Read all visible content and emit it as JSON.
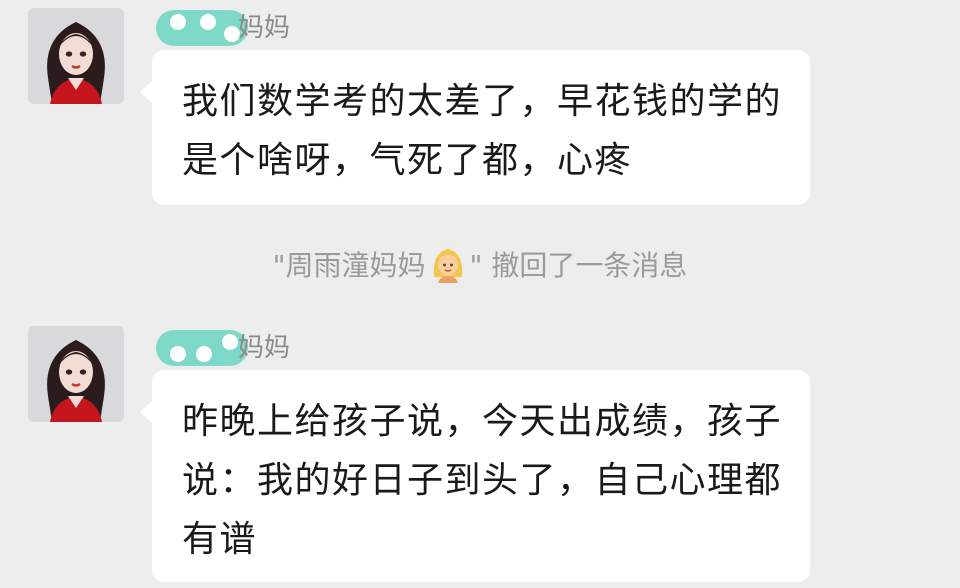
{
  "messages": [
    {
      "sender": "妈妈",
      "text": "我们数学考的太差了，早花钱的学的是个啥呀，气死了都，心疼"
    },
    {
      "sender": "妈妈",
      "text": "昨晚上给孩子说，今天出成绩，孩子说：我的好日子到头了，自己心理都有谱"
    }
  ],
  "system_notice": {
    "quote_open": "\"",
    "name": "周雨潼妈妈",
    "emoji": "person-blond-hair-emoji",
    "quote_close": "\"",
    "action": " 撤回了一条消息"
  },
  "colors": {
    "background": "#ededed",
    "bubble": "#ffffff",
    "name_mask": "#7fd9c8",
    "system_text": "#9a9a9a"
  }
}
